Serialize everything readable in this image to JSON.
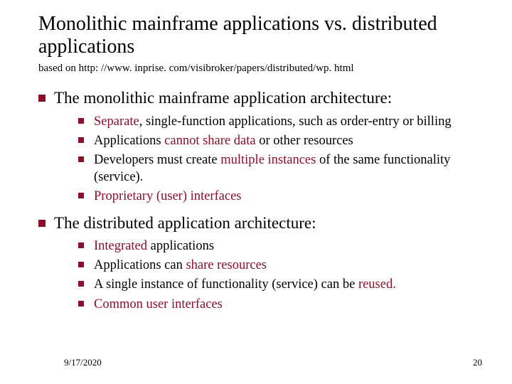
{
  "title": "Monolithic mainframe applications vs. distributed applications",
  "subtitle": "based on  http: //www. inprise. com/visibroker/papers/distributed/wp. html",
  "sections": [
    {
      "heading": "The monolithic mainframe application architecture:",
      "items": [
        {
          "pre": "",
          "accent": "Separate",
          "post": ", single-function applications, such as order-entry or billing"
        },
        {
          "pre": "Applications ",
          "accent": "cannot share data",
          "post": " or other resources"
        },
        {
          "pre": "Developers must create ",
          "accent": "multiple instances",
          "post": " of the same functionality (service)."
        },
        {
          "pre": "",
          "accent": "Proprietary (user) interfaces",
          "post": ""
        }
      ]
    },
    {
      "heading": "The distributed application architecture:",
      "items": [
        {
          "pre": "",
          "accent": "Integrated",
          "post": " applications"
        },
        {
          "pre": "Applications can ",
          "accent": "share resources",
          "post": ""
        },
        {
          "pre": "A single instance of functionality (service) can be ",
          "accent": "reused.",
          "post": ""
        },
        {
          "pre": "",
          "accent": "Common user interfaces",
          "post": ""
        }
      ]
    }
  ],
  "footer": {
    "date": "9/17/2020",
    "page": "20"
  }
}
